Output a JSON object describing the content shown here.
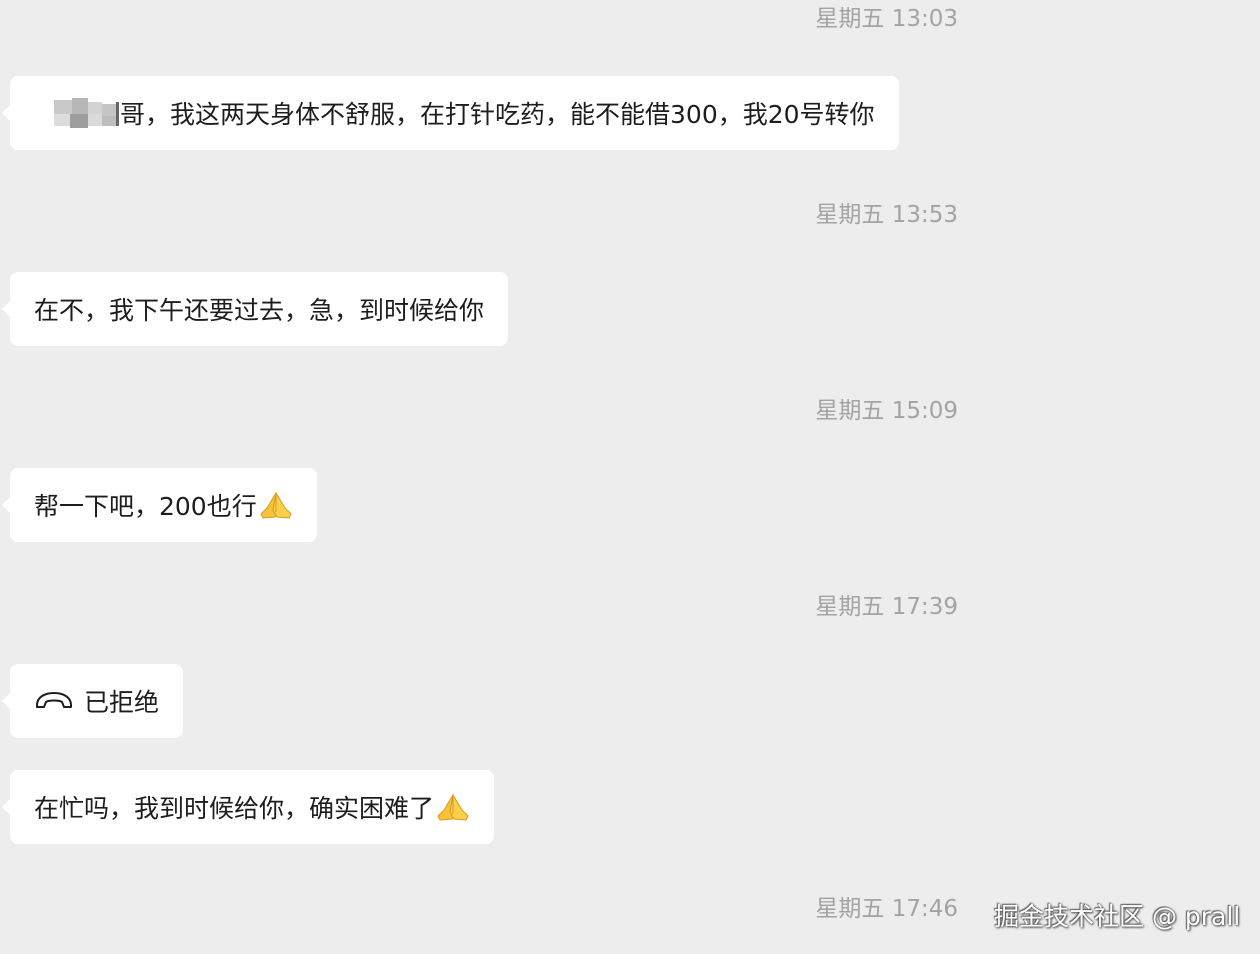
{
  "messages": [
    {
      "timestamp": "星期五 13:03",
      "text": "哥，我这两天身体不舒服，在打针吃药，能不能借300，我20号转你",
      "sender_name_blurred": true
    },
    {
      "timestamp": "星期五 13:53",
      "text": "在不，我下午还要过去，急，到时候给你"
    },
    {
      "timestamp": "星期五 15:09",
      "text": "帮一下吧，200也行",
      "emoji": "folded-hands"
    },
    {
      "timestamp": "星期五 17:39",
      "call_status": "已拒绝",
      "icon": "phone-hangup-icon"
    },
    {
      "text": "在忙吗，我到时候给你，确实困难了",
      "emoji": "folded-hands"
    },
    {
      "timestamp": "星期五 17:46"
    }
  ],
  "watermark": "掘金技术社区 @ prall",
  "colors": {
    "background": "#ededed",
    "bubble": "#ffffff",
    "timestamp": "#a3a3a3",
    "text": "#1d1d1d"
  }
}
